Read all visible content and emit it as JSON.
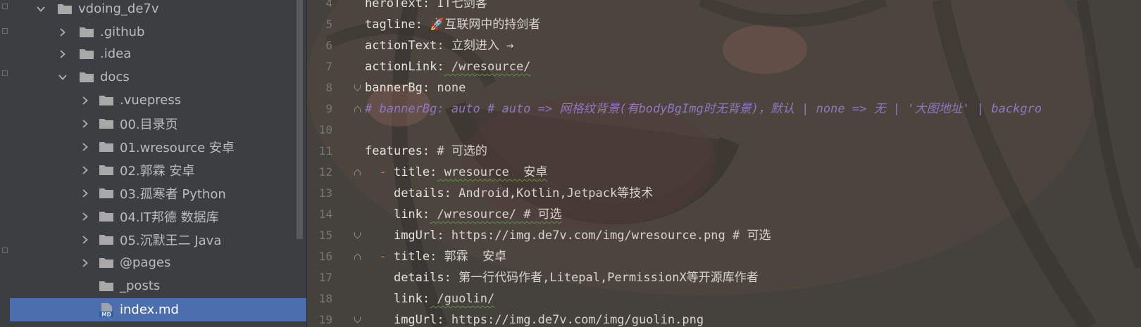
{
  "project_tree": {
    "items": [
      {
        "label": "vdoing_de7v",
        "expanded": true,
        "type": "folder"
      },
      {
        "label": ".github",
        "expanded": false,
        "type": "folder"
      },
      {
        "label": ".idea",
        "expanded": false,
        "type": "folder"
      },
      {
        "label": "docs",
        "expanded": true,
        "type": "folder"
      },
      {
        "label": ".vuepress",
        "expanded": false,
        "type": "folder"
      },
      {
        "label": "00.目录页",
        "expanded": false,
        "type": "folder"
      },
      {
        "label": "01.wresource  安卓",
        "expanded": false,
        "type": "folder"
      },
      {
        "label": "02.郭霖  安卓",
        "expanded": false,
        "type": "folder"
      },
      {
        "label": "03.孤寒者 Python",
        "expanded": false,
        "type": "folder"
      },
      {
        "label": "04.IT邦德 数据库",
        "expanded": false,
        "type": "folder"
      },
      {
        "label": "05.沉默王二 Java",
        "expanded": false,
        "type": "folder"
      },
      {
        "label": "@pages",
        "expanded": false,
        "type": "folder"
      },
      {
        "label": "_posts",
        "expanded": false,
        "type": "folder"
      },
      {
        "label": "index.md",
        "type": "file",
        "selected": true,
        "icon_text": "MD"
      }
    ]
  },
  "editor": {
    "lines": [
      {
        "no": "4",
        "key": "heroText:",
        "value": " IT七剑客"
      },
      {
        "no": "5",
        "key": "tagline:",
        "value": " 🚀互联网中的持剑者"
      },
      {
        "no": "6",
        "key": "actionText:",
        "value": " 立刻进入 →"
      },
      {
        "no": "7",
        "key": "actionLink:",
        "value": " /wresource/"
      },
      {
        "no": "8",
        "key": "bannerBg:",
        "value": " none"
      },
      {
        "no": "9",
        "comment": "# bannerBg: auto # auto => 网格纹背景(有bodyBgImg时无背景)，默认 | none => 无 | '大图地址' | backgro"
      },
      {
        "no": "10"
      },
      {
        "no": "11",
        "key": "features:",
        "value": " # 可选的"
      },
      {
        "no": "12",
        "dash": "  - ",
        "key": "title:",
        "value": " wresource  安卓"
      },
      {
        "no": "13",
        "indent": "    ",
        "key": "details:",
        "value": " Android,Kotlin,Jetpack等技术"
      },
      {
        "no": "14",
        "indent": "    ",
        "key": "link:",
        "value": " /wresource/ # 可选"
      },
      {
        "no": "15",
        "indent": "    ",
        "key": "imgUrl:",
        "value": " https://img.de7v.com/img/wresource.png # 可选"
      },
      {
        "no": "16",
        "dash": "  - ",
        "key": "title:",
        "value": " 郭霖  安卓"
      },
      {
        "no": "17",
        "indent": "    ",
        "key": "details:",
        "value": " 第一行代码作者,Litepal,PermissionX等开源库作者"
      },
      {
        "no": "18",
        "indent": "    ",
        "key": "link:",
        "value": " /guolin/"
      },
      {
        "no": "19",
        "indent": "    ",
        "key": "imgUrl:",
        "value": " https://img.de7v.com/img/guolin.png"
      }
    ]
  },
  "colors": {
    "tree_bg": "#3c3f41",
    "selection": "#4b6eaf",
    "editor_bg": "#44403c",
    "comment": "#8f76c2",
    "dash": "#cc7832"
  }
}
